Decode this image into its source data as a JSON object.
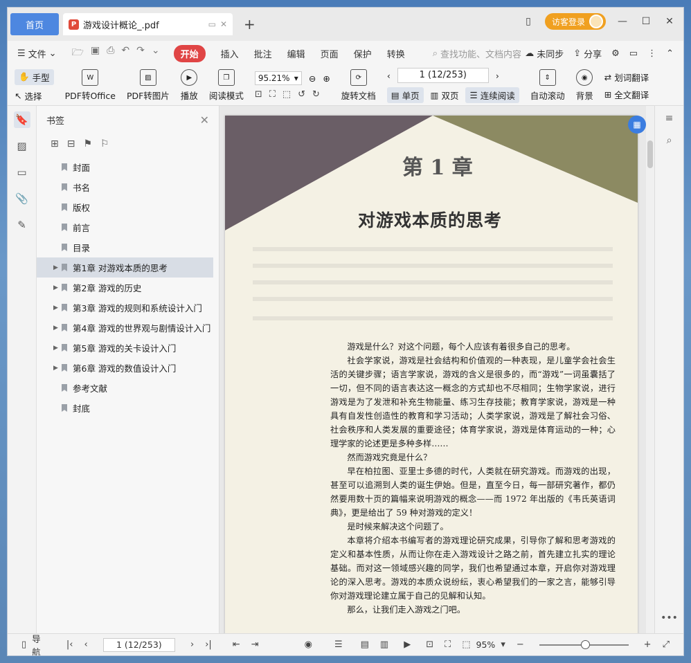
{
  "tabs": {
    "home": "首页",
    "document": "游戏设计概论_.pdf",
    "new_tab": "+"
  },
  "title_bar": {
    "login": "访客登录"
  },
  "menu": {
    "file": "文件",
    "items": [
      "开始",
      "插入",
      "批注",
      "编辑",
      "页面",
      "保护",
      "转换"
    ],
    "search_placeholder": "查找功能、文档内容",
    "sync": "未同步",
    "share": "分享"
  },
  "toolbar": {
    "hand": "手型",
    "select": "选择",
    "pdf_to_office": "PDF转Office",
    "pdf_to_image": "PDF转图片",
    "play": "播放",
    "read_mode": "阅读模式",
    "zoom": "95.21%",
    "rotate": "旋转文档",
    "page": "1 (12/253)",
    "single": "单页",
    "double": "双页",
    "continuous": "连续阅读",
    "auto_scroll": "自动滚动",
    "background": "背景",
    "word_translate": "划词翻译",
    "full_translate": "全文翻译"
  },
  "bookmarks": {
    "title": "书签",
    "items": [
      {
        "label": "封面",
        "expandable": false
      },
      {
        "label": "书名",
        "expandable": false
      },
      {
        "label": "版权",
        "expandable": false
      },
      {
        "label": "前言",
        "expandable": false
      },
      {
        "label": "目录",
        "expandable": false
      },
      {
        "label": "第1章 对游戏本质的思考",
        "expandable": true
      },
      {
        "label": "第2章 游戏的历史",
        "expandable": true
      },
      {
        "label": "第3章 游戏的规则和系统设计入门",
        "expandable": true
      },
      {
        "label": "第4章 游戏的世界观与剧情设计入门",
        "expandable": true
      },
      {
        "label": "第5章 游戏的关卡设计入门",
        "expandable": true
      },
      {
        "label": "第6章 游戏的数值设计入门",
        "expandable": true
      },
      {
        "label": "参考文献",
        "expandable": false
      },
      {
        "label": "封底",
        "expandable": false
      }
    ]
  },
  "page_content": {
    "chapter_num": "第 1 章",
    "chapter_title": "对游戏本质的思考",
    "paragraphs": [
      "游戏是什么？对这个问题，每个人应该有着很多自己的思考。",
      "社会学家说，游戏是社会结构和价值观的一种表现，是儿童学会社会生活的关键步骤；语言学家说，游戏的含义是很多的，而“游戏”一词虽囊括了一切，但不同的语言表达这一概念的方式却也不尽相同；生物学家说，进行游戏是为了发泄和补充生物能量、练习生存技能；教育学家说，游戏是一种具有自发性创造性的教育和学习活动；人类学家说，游戏是了解社会习俗、社会秩序和人类发展的重要途径；体育学家说，游戏是体育运动的一种；心理学家的论述更是多种多样……",
      "然而游戏究竟是什么？",
      "早在柏拉图、亚里士多德的时代，人类就在研究游戏。而游戏的出现，甚至可以追溯到人类的诞生伊始。但是，直至今日，每一部研究著作，都仍然要用数十页的篇幅来说明游戏的概念——而 1972 年出版的《韦氏英语词典》，更是给出了 59 种对游戏的定义！",
      "是时候来解决这个问题了。",
      "本章将介绍本书编写者的游戏理论研究成果，引导你了解和思考游戏的定义和基本性质，从而让你在走入游戏设计之路之前，首先建立扎实的理论基础。而对这一领域感兴趣的同学，我们也希望通过本章，开启你对游戏理论的深入思考。游戏的本质众说纷纭，衷心希望我们的一家之言，能够引导你对游戏理论建立属于自己的见解和认知。",
      "那么，让我们走入游戏之门吧。"
    ]
  },
  "status": {
    "nav": "导航",
    "page": "1 (12/253)",
    "zoom": "95%"
  },
  "colors": {
    "accent": "#4d87e0",
    "start": "#e04545",
    "login": "#f0a020"
  }
}
